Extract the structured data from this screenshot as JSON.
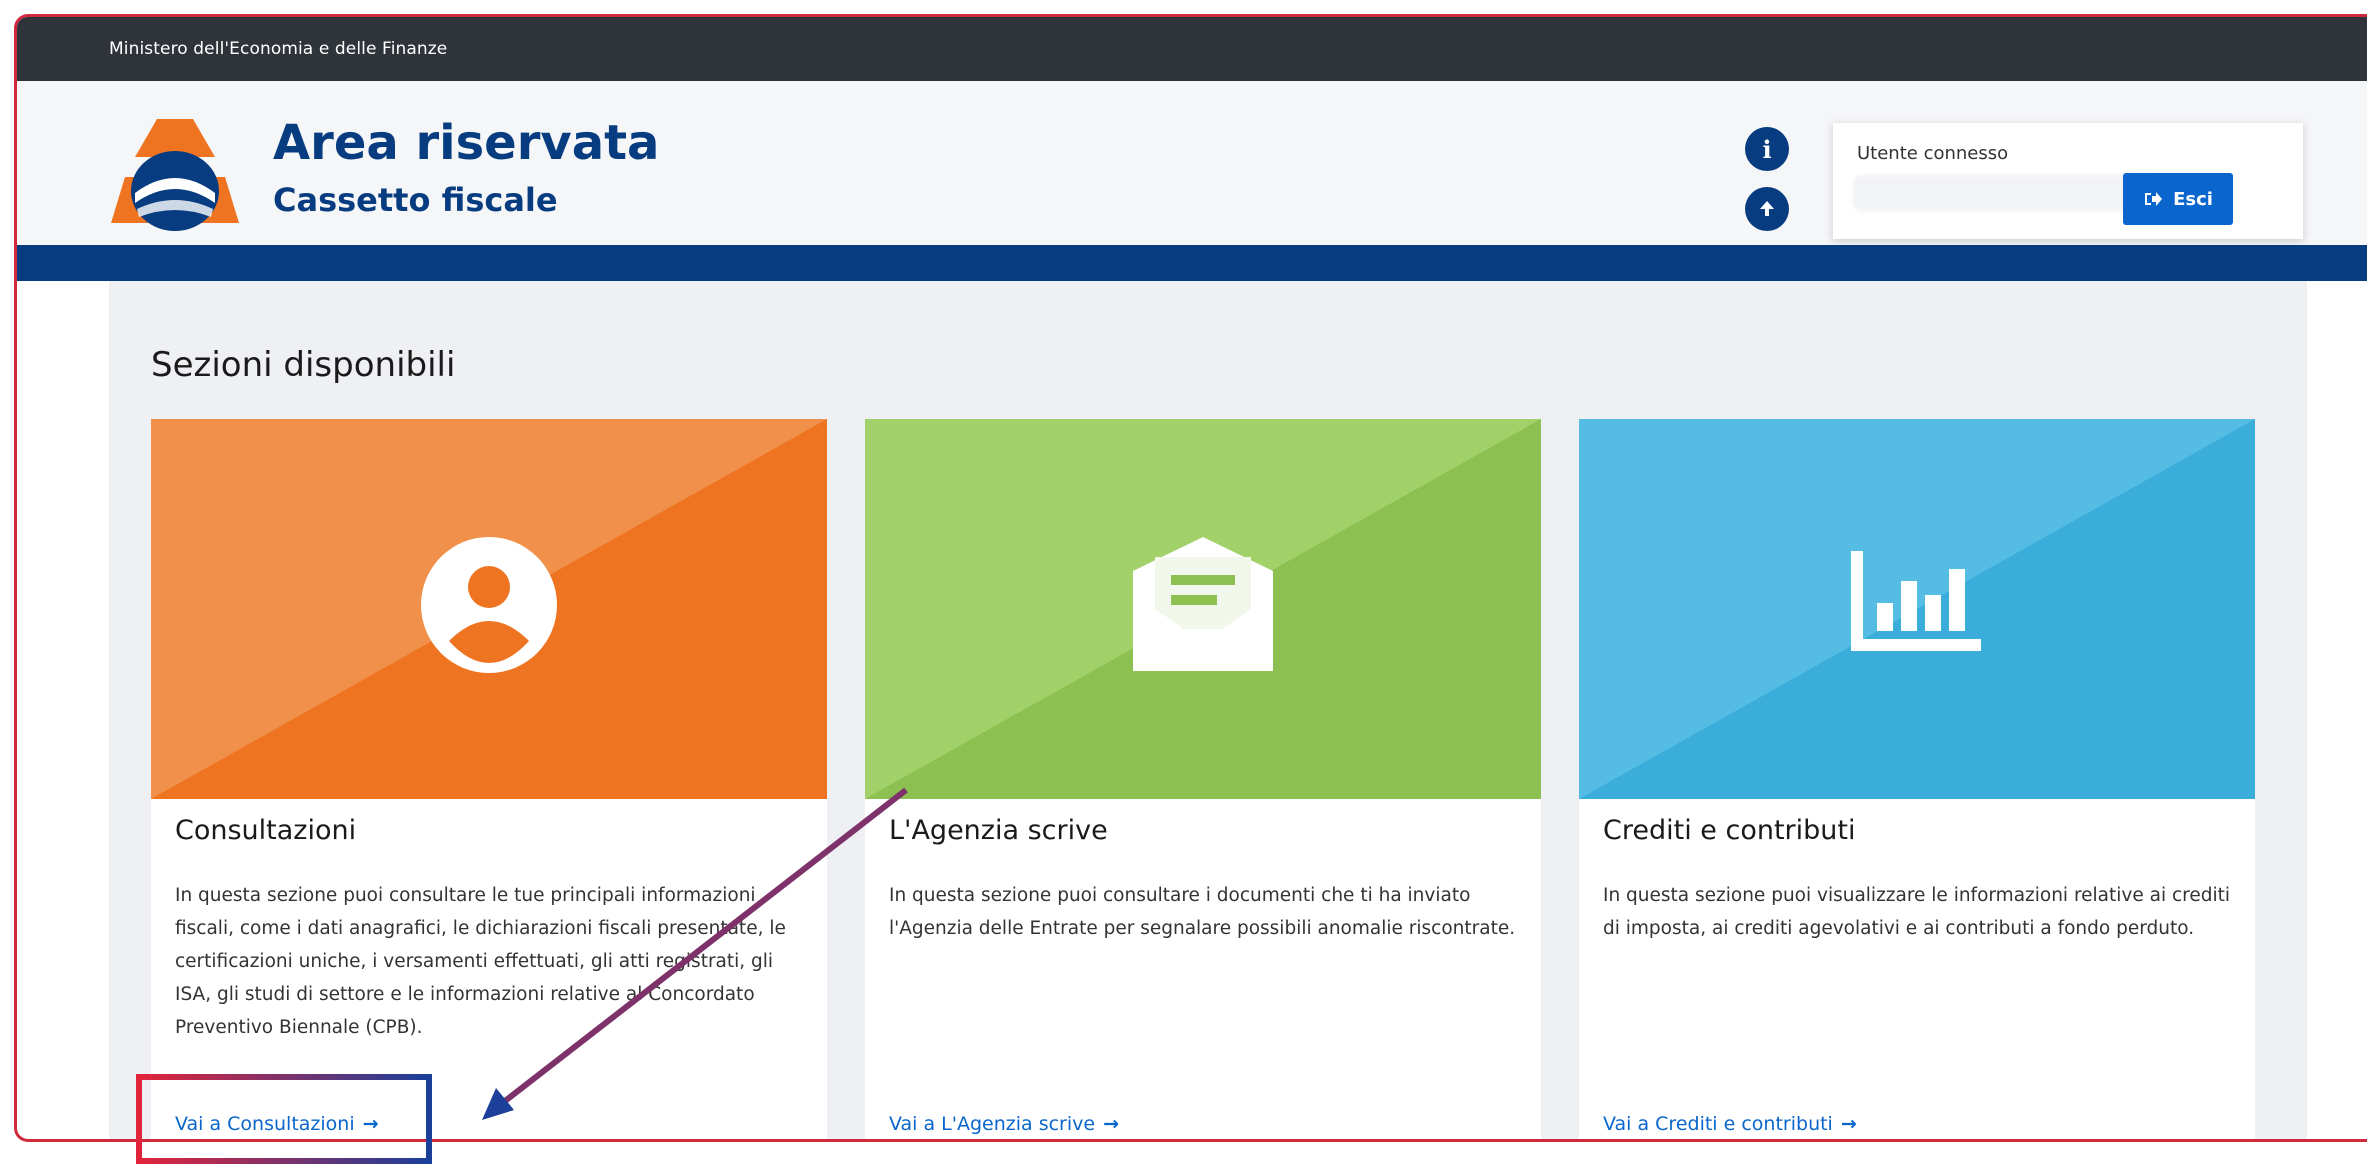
{
  "topbar": {
    "ministry": "Ministero dell'Economia e delle Finanze"
  },
  "brand": {
    "title": "Area riservata",
    "subtitle": "Cassetto fiscale"
  },
  "header": {
    "info_icon": "info-icon",
    "upload_icon": "upload-icon",
    "user_label": "Utente connesso",
    "logout_label": "Esci"
  },
  "main": {
    "section_title": "Sezioni disponibili",
    "cards": [
      {
        "title": "Consultazioni",
        "description": "In questa sezione puoi consultare le tue principali informazioni fiscali, come i dati anagrafici, le dichiarazioni fiscali presentate, le certificazioni uniche, i versamenti effettuati, gli atti registrati, gli ISA, gli studi di settore e le informazioni relative al Concordato Preventivo Biennale (CPB).",
        "link": "Vai a Consultazioni",
        "icon": "user-icon",
        "color": "#ee7422"
      },
      {
        "title": "L'Agenzia scrive",
        "description": "In questa sezione puoi consultare i documenti che ti ha inviato l'Agenzia delle Entrate per segnalare possibili anomalie riscontrate.",
        "link": "Vai a L'Agenzia scrive",
        "icon": "envelope-icon",
        "color": "#8cc152"
      },
      {
        "title": "Crediti e contributi",
        "description": "In questa sezione puoi visualizzare le informazioni relative ai crediti di imposta, ai crediti agevolativi e ai contributi a fondo perduto.",
        "link": "Vai a Crediti e contributi",
        "icon": "bar-chart-icon",
        "color": "#3aaddb"
      }
    ]
  },
  "colors": {
    "brand_blue": "#083c80",
    "link_blue": "#0a66cc",
    "annotation_red": "#d0283d"
  }
}
